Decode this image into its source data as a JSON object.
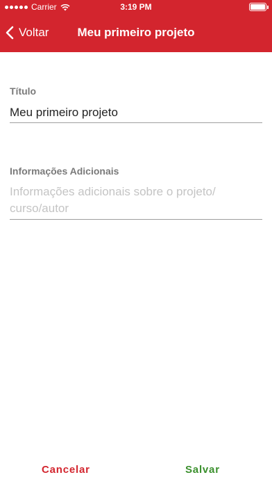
{
  "status_bar": {
    "carrier": "Carrier",
    "time": "3:19 PM",
    "icons": [
      "signal-dots-icon",
      "wifi-icon",
      "battery-icon"
    ]
  },
  "nav": {
    "back_label": "Voltar",
    "back_icon": "chevron-left-icon",
    "title": "Meu primeiro projeto"
  },
  "form": {
    "title_label": "Título",
    "title_value": "Meu primeiro projeto",
    "info_label": "Informações Adicionais",
    "info_value": "",
    "info_placeholder": "Informações adicionais sobre o projeto/ curso/autor"
  },
  "footer": {
    "cancel_label": "Cancelar",
    "save_label": "Salvar"
  },
  "colors": {
    "header_bg": "#d3252e",
    "cancel": "#d3252e",
    "save": "#3a8f2c",
    "label": "#7a7a7a",
    "placeholder": "#c4c4c4"
  }
}
